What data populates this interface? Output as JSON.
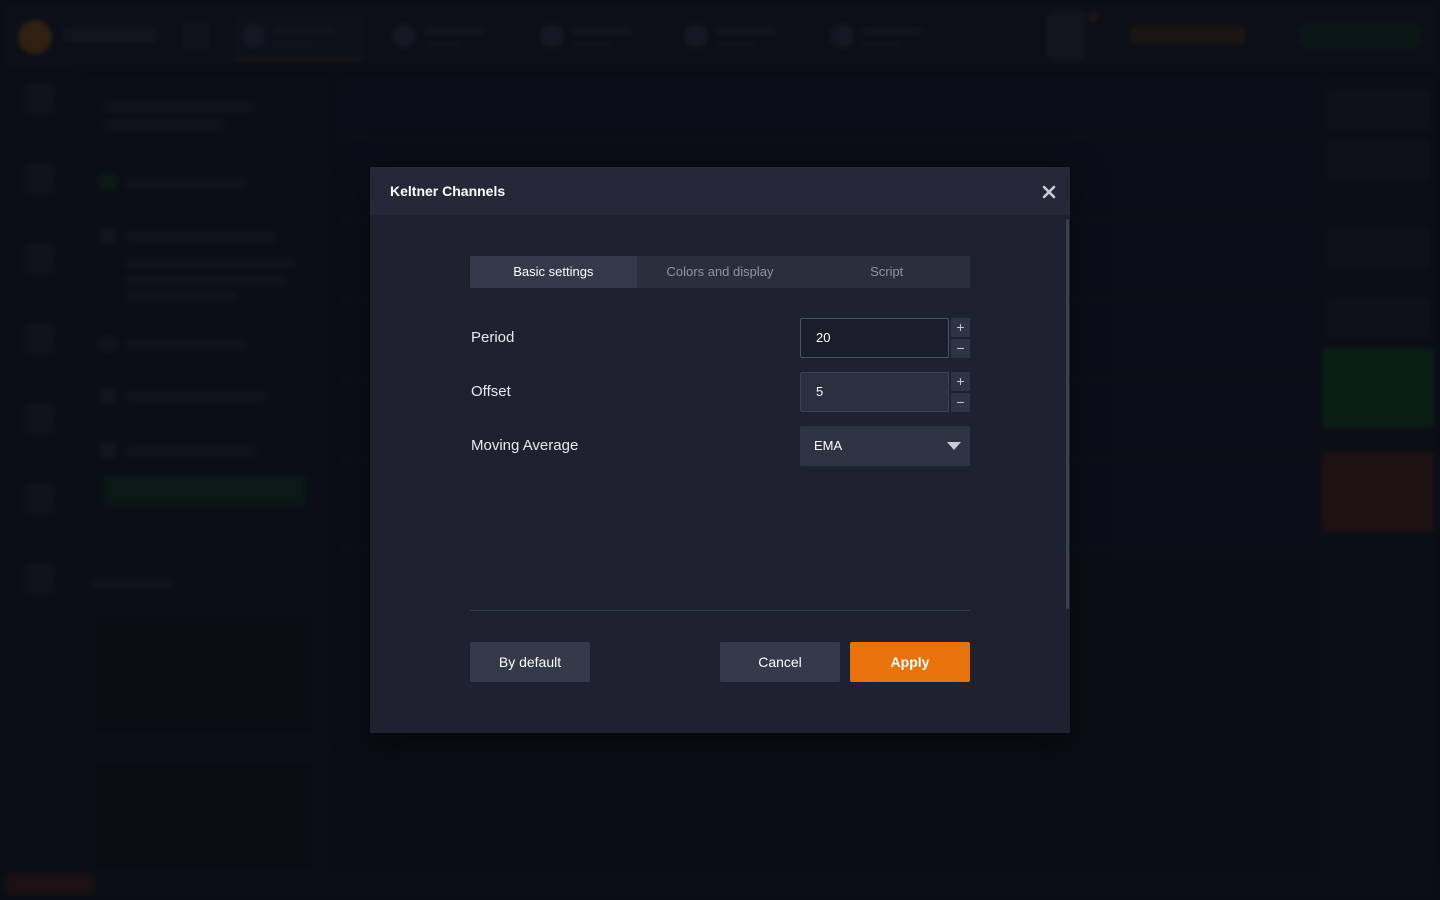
{
  "dialog": {
    "title": "Keltner Channels",
    "tabs": [
      {
        "label": "Basic settings",
        "active": true
      },
      {
        "label": "Colors and display",
        "active": false
      },
      {
        "label": "Script",
        "active": false
      }
    ],
    "fields": {
      "period": {
        "label": "Period",
        "value": "20"
      },
      "offset": {
        "label": "Offset",
        "value": "5"
      },
      "moving_average": {
        "label": "Moving Average",
        "value": "EMA"
      }
    },
    "stepper": {
      "plus": "+",
      "minus": "−"
    },
    "buttons": {
      "by_default": "By default",
      "cancel": "Cancel",
      "apply": "Apply"
    }
  },
  "colors": {
    "accent": "#e8730c",
    "modal_bg": "#1d2130",
    "header_bg": "#242838"
  },
  "icons": {
    "close": "close-icon",
    "caret": "chevron-down-icon"
  }
}
